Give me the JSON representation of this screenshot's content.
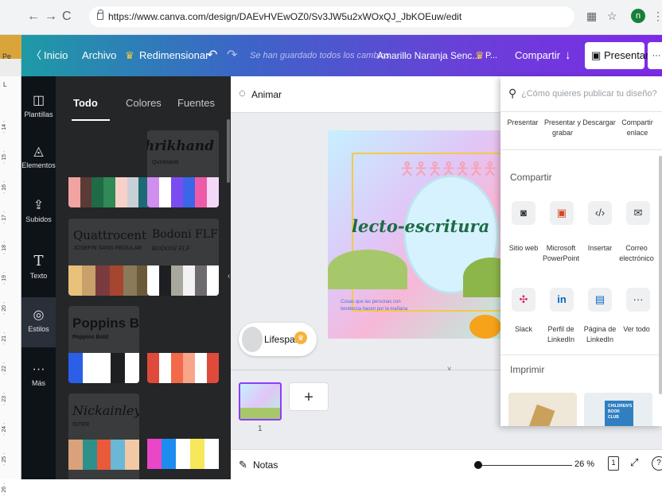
{
  "browser": {
    "url": "https://www.canva.com/design/DAEvHVEwOZ0/Sv3JW5u2xWOxQJ_JbKOEuw/edit",
    "avatar_letter": "n",
    "left_tab_text": "Pe"
  },
  "topbar": {
    "home": "Inicio",
    "file": "Archivo",
    "resize": "Redimensionar",
    "saved_status": "Se han guardado todos los cambios",
    "doc_title": "Amarillo Naranja Senc...",
    "premium_label": "P...",
    "share": "Compartir",
    "present": "Presentar",
    "more": "···"
  },
  "rail": [
    {
      "label": "Plantillas",
      "icon": "template-icon"
    },
    {
      "label": "Elementos",
      "icon": "shapes-icon"
    },
    {
      "label": "Subidos",
      "icon": "upload-icon"
    },
    {
      "label": "Texto",
      "icon": "text-icon"
    },
    {
      "label": "Estilos",
      "icon": "palette-icon"
    },
    {
      "label": "Más",
      "icon": "more-icon"
    }
  ],
  "panel": {
    "tabs": [
      "Todo",
      "Colores",
      "Fuentes"
    ],
    "styles": [
      {
        "title": "Shrikhand",
        "subtitle": "Quicksand",
        "colors": [
          "#f0a3a0",
          "#1e6b45",
          "#f7d1c8",
          "#c9cfd6",
          "#1c6a73"
        ]
      },
      {
        "title": "Quattrocento",
        "subtitle": "JOSEFIN SANS REGULAR",
        "colors": [
          "#e8c27a",
          "#7a3b3f",
          "#c7a06a",
          "#8a7a5a"
        ]
      },
      {
        "title": "Bodoni FLF",
        "subtitle": "BODONI FLF",
        "colors": [
          "#ffffff",
          "#1d1f22",
          "#a9a89c",
          "#f2f2f2",
          "#6d6b70"
        ]
      },
      {
        "title": "Poppins Bolc",
        "subtitle": "Poppins Bold",
        "colors": [
          "#2b5fe8",
          "#ffffff",
          "#1d1f22",
          "#ffffff"
        ]
      },
      {
        "title": "",
        "subtitle": "",
        "colors": [
          "#e04a3a",
          "#ffffff",
          "#f26a4a",
          "#f8a58a",
          "#ffffff"
        ]
      },
      {
        "title": "Nickainley",
        "subtitle": "INTER",
        "colors": [
          "#d9a27a",
          "#2f8f8a",
          "#e85a3a",
          "#6ab8d6"
        ]
      },
      {
        "title": "",
        "subtitle": "",
        "colors": [
          "#e946c8",
          "#1d8cf0",
          "#ffffff",
          "#f7e75a"
        ]
      }
    ]
  },
  "canvas": {
    "animate": "Animar",
    "slide_title": "lecto-escritura",
    "slide_caption": "Cosas que las personas con tendencia hacen por la mañana",
    "lifespan": "Lifespan",
    "page_number": "1",
    "add_page": "+",
    "notes": "Notas",
    "zoom": "26 %",
    "page_icon_label": "1",
    "help": "?"
  },
  "share_menu": {
    "search_placeholder": "¿Cómo quieres publicar tu diseño?",
    "top_actions": [
      "Presentar",
      "Presentar y grabar",
      "Descargar",
      "Compartir enlace"
    ],
    "share_heading": "Compartir",
    "share_items_row1": [
      "Sitio web",
      "Microsoft PowerPoint",
      "Insertar",
      "Correo electrónico"
    ],
    "share_items_row2": [
      "Slack",
      "Perfil de LinkedIn",
      "Página de LinkedIn",
      "Ver todo"
    ],
    "print_heading": "Imprimir",
    "print_card_text": "CHILDREN'S BOOK CLUB"
  },
  "ruler_ticks": [
    "14",
    "15",
    "16",
    "17",
    "18",
    "19",
    "20",
    "21",
    "22",
    "23",
    "24",
    "25",
    "26"
  ]
}
